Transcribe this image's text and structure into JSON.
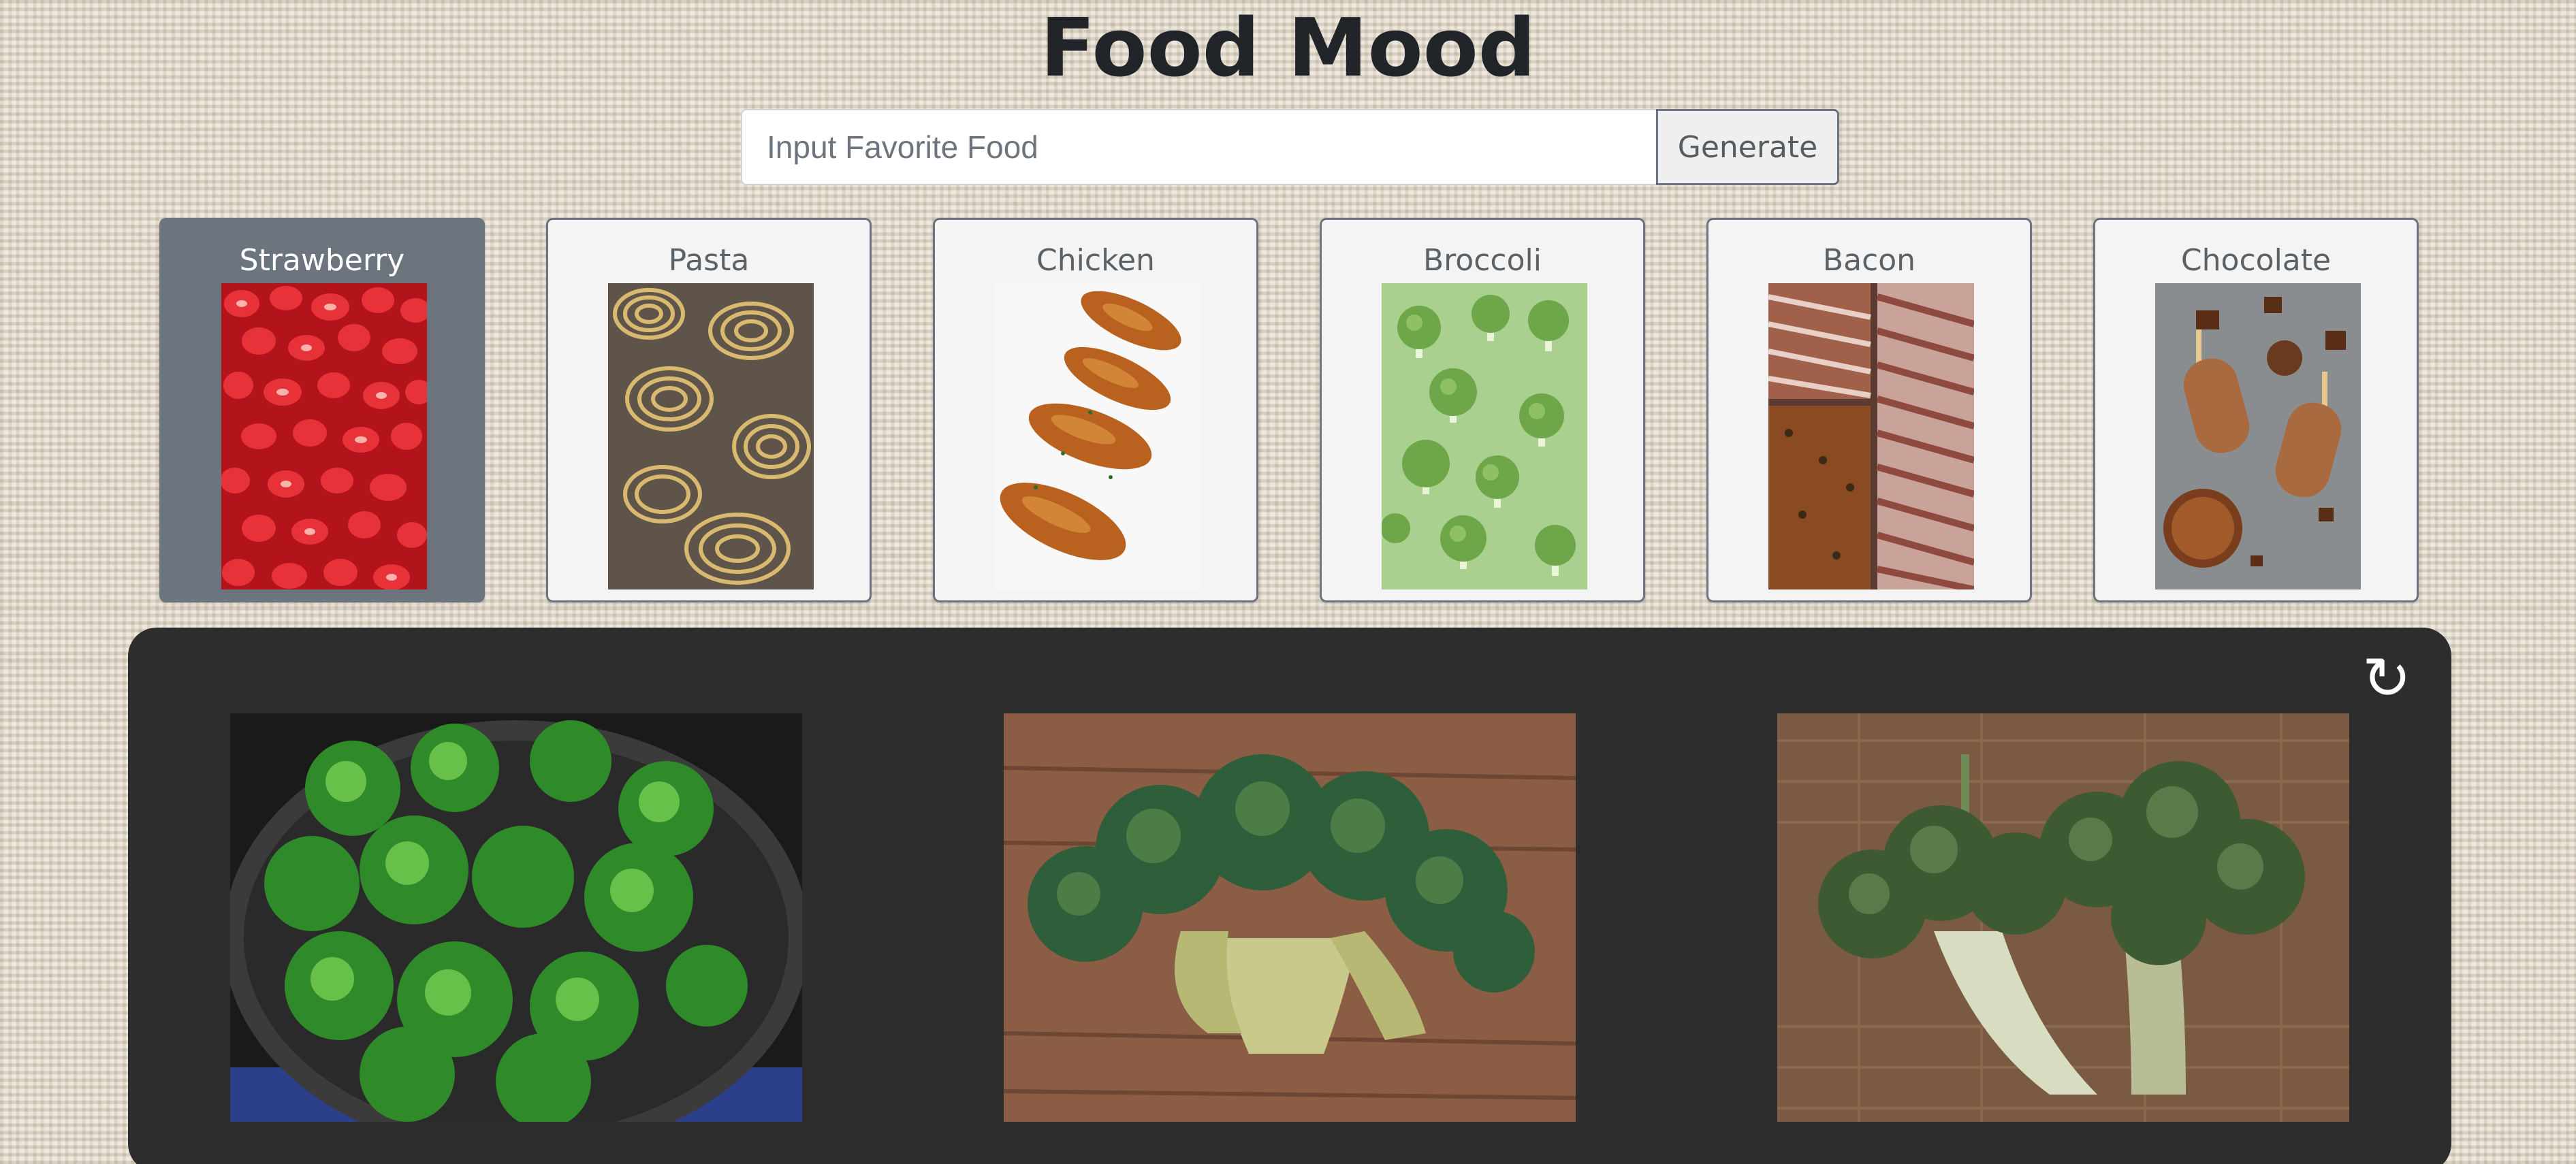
{
  "app": {
    "title": "Food Mood"
  },
  "search": {
    "placeholder": "Input Favorite Food",
    "value": "",
    "button_label": "Generate"
  },
  "foods": [
    {
      "label": "Strawberry",
      "selected": true,
      "image": "strawberries-photo"
    },
    {
      "label": "Pasta",
      "selected": false,
      "image": "pasta-nests-photo"
    },
    {
      "label": "Chicken",
      "selected": false,
      "image": "fried-chicken-photo"
    },
    {
      "label": "Broccoli",
      "selected": false,
      "image": "broccoli-florets-photo"
    },
    {
      "label": "Bacon",
      "selected": false,
      "image": "bacon-photo"
    },
    {
      "label": "Chocolate",
      "selected": false,
      "image": "chocolate-popsicles-photo"
    }
  ],
  "results": {
    "refresh_icon": "refresh-icon",
    "images": [
      "broccoli-in-pot-photo",
      "broccoli-head-on-wood-photo",
      "broccoli-on-burlap-photo"
    ]
  },
  "colors": {
    "title": "#212529",
    "selected_card": "#6c757d",
    "card_bg": "#f4f4f4",
    "panel_bg": "#2d2d2d"
  }
}
